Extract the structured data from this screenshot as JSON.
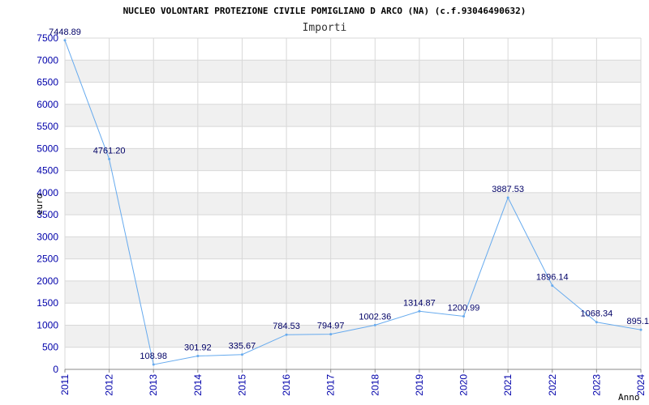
{
  "chart_data": {
    "type": "line",
    "title": "NUCLEO VOLONTARI PROTEZIONE CIVILE POMIGLIANO D ARCO (NA) (c.f.93046490632)",
    "subtitle": "Importi",
    "xlabel": "Anno",
    "ylabel": "euro",
    "ylim": [
      0,
      7500
    ],
    "yticks": [
      0,
      500,
      1000,
      1500,
      2000,
      2500,
      3000,
      3500,
      4000,
      4500,
      5000,
      5500,
      6000,
      6500,
      7000,
      7500
    ],
    "x": [
      "2011",
      "2012",
      "2013",
      "2014",
      "2015",
      "2016",
      "2017",
      "2018",
      "2019",
      "2020",
      "2021",
      "2022",
      "2023",
      "2024"
    ],
    "series": [
      {
        "values": [
          7448.89,
          4761.2,
          108.98,
          301.92,
          335.67,
          784.53,
          794.97,
          1002.36,
          1314.87,
          1200.99,
          3887.53,
          1896.14,
          1068.34,
          895.1
        ],
        "labels": [
          "7448.89",
          "4761.20",
          "108.98",
          "301.92",
          "335.67",
          "784.53",
          "794.97",
          "1002.36",
          "1314.87",
          "1200.99",
          "3887.53",
          "1896.14",
          "1068.34",
          "895.1"
        ],
        "color": "#66aaee"
      }
    ],
    "grid": true,
    "band_color": "#f0f0f0",
    "tick_color": "#0000aa"
  }
}
